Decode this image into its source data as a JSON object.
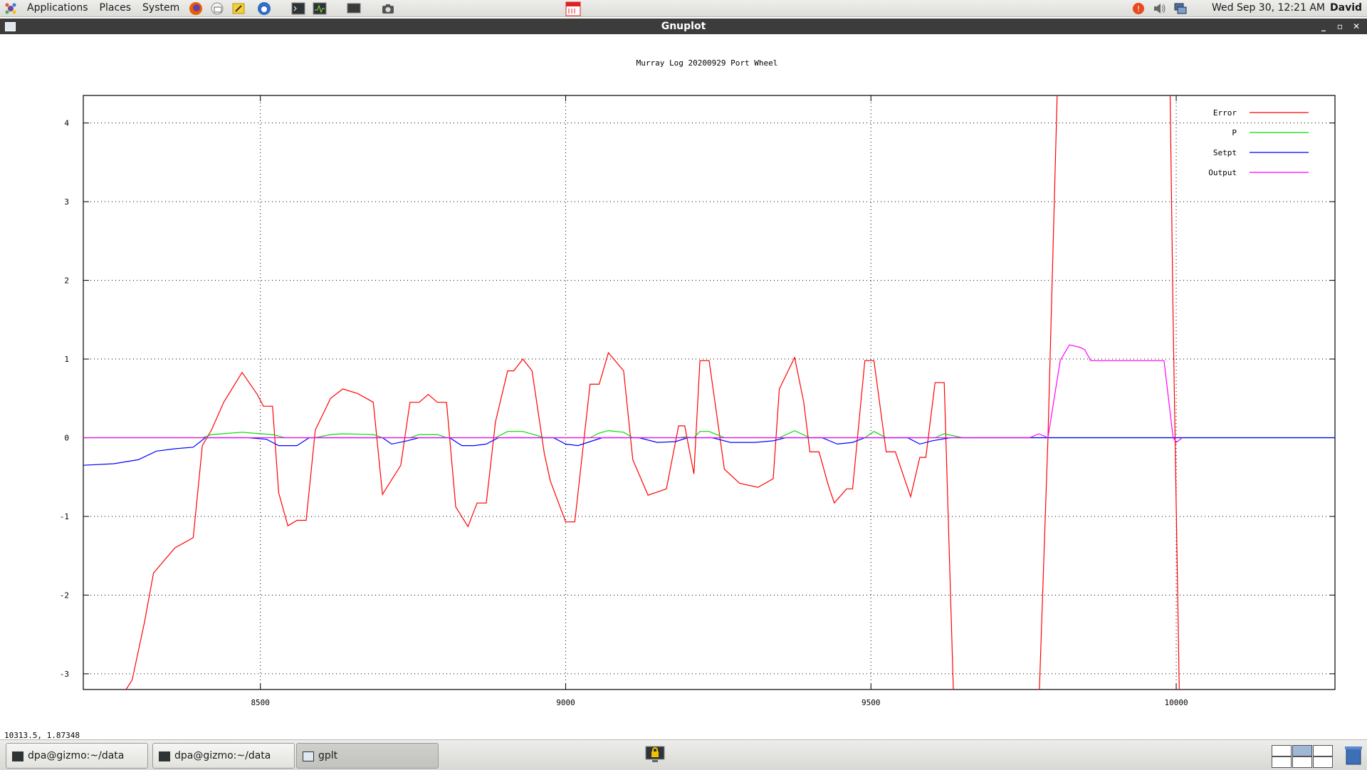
{
  "top_panel": {
    "menus": [
      "Applications",
      "Places",
      "System"
    ],
    "clock": "Wed Sep 30, 12:21 AM",
    "user": "David",
    "launchers": [
      "firefox-icon",
      "mail-icon",
      "notes-icon",
      "thunderbird-icon",
      "terminal-icon",
      "system-monitor-icon",
      "screen-icon",
      "camera-icon",
      "calendar-icon"
    ],
    "tray": [
      "update-icon",
      "volume-icon",
      "network-icon"
    ]
  },
  "window": {
    "title": "Gnuplot",
    "controls": [
      "_",
      "▫",
      "✕"
    ]
  },
  "status": {
    "coordinates": "10313.5,  1.87348"
  },
  "taskbar": {
    "items": [
      {
        "label": "dpa@gizmo:~/data"
      },
      {
        "label": "dpa@gizmo:~/data"
      },
      {
        "label": "gplt"
      }
    ]
  },
  "chart_data": {
    "type": "line",
    "title": "Murray Log 20200929 Port Wheel",
    "xlabel": "",
    "ylabel": "",
    "xlim": [
      8210,
      10260
    ],
    "ylim": [
      -3.2,
      4.35
    ],
    "x_ticks": [
      "8500",
      "9000",
      "9500",
      "10000"
    ],
    "x_tick_values": [
      8500,
      9000,
      9500,
      10000
    ],
    "y_ticks": [
      "4",
      "3",
      "2",
      "1",
      "0",
      "-1",
      "-2",
      "-3"
    ],
    "y_tick_values": [
      4,
      3,
      2,
      1,
      0,
      -1,
      -2,
      -3
    ],
    "grid": true,
    "legend_position": "top-right",
    "series": [
      {
        "name": "Error",
        "color": "#ff0000",
        "points": [
          [
            8280,
            -3.2
          ],
          [
            8290,
            -3.08
          ],
          [
            8310,
            -2.35
          ],
          [
            8325,
            -1.72
          ],
          [
            8360,
            -1.4
          ],
          [
            8390,
            -1.27
          ],
          [
            8405,
            -0.1
          ],
          [
            8420,
            0.1
          ],
          [
            8440,
            0.45
          ],
          [
            8470,
            0.83
          ],
          [
            8495,
            0.55
          ],
          [
            8505,
            0.4
          ],
          [
            8520,
            0.4
          ],
          [
            8530,
            -0.7
          ],
          [
            8545,
            -1.12
          ],
          [
            8560,
            -1.05
          ],
          [
            8575,
            -1.05
          ],
          [
            8590,
            0.1
          ],
          [
            8615,
            0.5
          ],
          [
            8635,
            0.62
          ],
          [
            8660,
            0.56
          ],
          [
            8685,
            0.45
          ],
          [
            8700,
            -0.72
          ],
          [
            8730,
            -0.35
          ],
          [
            8745,
            0.45
          ],
          [
            8760,
            0.45
          ],
          [
            8775,
            0.55
          ],
          [
            8790,
            0.45
          ],
          [
            8805,
            0.45
          ],
          [
            8820,
            -0.88
          ],
          [
            8840,
            -1.13
          ],
          [
            8855,
            -0.83
          ],
          [
            8870,
            -0.83
          ],
          [
            8885,
            0.2
          ],
          [
            8905,
            0.85
          ],
          [
            8915,
            0.85
          ],
          [
            8930,
            1.0
          ],
          [
            8945,
            0.85
          ],
          [
            8965,
            -0.2
          ],
          [
            8975,
            -0.55
          ],
          [
            9000,
            -1.07
          ],
          [
            9015,
            -1.07
          ],
          [
            9040,
            0.68
          ],
          [
            9055,
            0.68
          ],
          [
            9070,
            1.08
          ],
          [
            9095,
            0.85
          ],
          [
            9110,
            -0.28
          ],
          [
            9135,
            -0.73
          ],
          [
            9165,
            -0.65
          ],
          [
            9185,
            0.15
          ],
          [
            9195,
            0.15
          ],
          [
            9210,
            -0.46
          ],
          [
            9220,
            0.98
          ],
          [
            9235,
            0.98
          ],
          [
            9260,
            -0.4
          ],
          [
            9285,
            -0.58
          ],
          [
            9315,
            -0.63
          ],
          [
            9340,
            -0.52
          ],
          [
            9350,
            0.62
          ],
          [
            9375,
            1.02
          ],
          [
            9390,
            0.45
          ],
          [
            9400,
            -0.18
          ],
          [
            9415,
            -0.18
          ],
          [
            9430,
            -0.6
          ],
          [
            9440,
            -0.83
          ],
          [
            9460,
            -0.65
          ],
          [
            9470,
            -0.65
          ],
          [
            9490,
            0.98
          ],
          [
            9505,
            0.98
          ],
          [
            9525,
            -0.18
          ],
          [
            9540,
            -0.18
          ],
          [
            9565,
            -0.75
          ],
          [
            9580,
            -0.25
          ],
          [
            9590,
            -0.25
          ],
          [
            9605,
            0.7
          ],
          [
            9620,
            0.7
          ],
          [
            9635,
            -3.2
          ]
        ]
      },
      {
        "name": "Error",
        "color": "#ff0000",
        "points": [
          [
            9776,
            -3.2
          ],
          [
            9790,
            0.0
          ],
          [
            9805,
            4.35
          ]
        ]
      },
      {
        "name": "Error",
        "color": "#ff0000",
        "points": [
          [
            9990,
            4.35
          ],
          [
            9995,
            1.5
          ],
          [
            10005,
            -3.2
          ]
        ]
      },
      {
        "name": "P",
        "color": "#00dd00",
        "points": [
          [
            8210,
            0
          ],
          [
            8405,
            0
          ],
          [
            8420,
            0.04
          ],
          [
            8470,
            0.07
          ],
          [
            8500,
            0.05
          ],
          [
            8520,
            0.04
          ],
          [
            8540,
            0
          ],
          [
            8590,
            0
          ],
          [
            8615,
            0.04
          ],
          [
            8635,
            0.05
          ],
          [
            8685,
            0.04
          ],
          [
            8700,
            0
          ],
          [
            8745,
            0
          ],
          [
            8760,
            0.04
          ],
          [
            8790,
            0.04
          ],
          [
            8805,
            0
          ],
          [
            8885,
            0
          ],
          [
            8905,
            0.08
          ],
          [
            8930,
            0.08
          ],
          [
            8965,
            0
          ],
          [
            9040,
            0
          ],
          [
            9055,
            0.06
          ],
          [
            9070,
            0.09
          ],
          [
            9095,
            0.07
          ],
          [
            9110,
            0
          ],
          [
            9185,
            0
          ],
          [
            9195,
            0.01
          ],
          [
            9210,
            0
          ],
          [
            9220,
            0.08
          ],
          [
            9235,
            0.08
          ],
          [
            9260,
            0
          ],
          [
            9350,
            0
          ],
          [
            9375,
            0.09
          ],
          [
            9400,
            0
          ],
          [
            9490,
            0
          ],
          [
            9505,
            0.08
          ],
          [
            9525,
            0
          ],
          [
            9605,
            0
          ],
          [
            9620,
            0.05
          ],
          [
            9650,
            0
          ],
          [
            10260,
            0
          ]
        ]
      },
      {
        "name": "Setpt",
        "color": "#0000ff",
        "points": [
          [
            8210,
            -0.35
          ],
          [
            8260,
            -0.33
          ],
          [
            8300,
            -0.28
          ],
          [
            8330,
            -0.17
          ],
          [
            8360,
            -0.14
          ],
          [
            8390,
            -0.12
          ],
          [
            8410,
            0
          ],
          [
            8480,
            0
          ],
          [
            8510,
            -0.02
          ],
          [
            8530,
            -0.1
          ],
          [
            8560,
            -0.1
          ],
          [
            8580,
            0
          ],
          [
            8700,
            0
          ],
          [
            8715,
            -0.08
          ],
          [
            8740,
            -0.04
          ],
          [
            8760,
            0
          ],
          [
            8810,
            0
          ],
          [
            8830,
            -0.1
          ],
          [
            8850,
            -0.1
          ],
          [
            8870,
            -0.08
          ],
          [
            8890,
            0
          ],
          [
            8980,
            0
          ],
          [
            9000,
            -0.08
          ],
          [
            9020,
            -0.1
          ],
          [
            9040,
            -0.05
          ],
          [
            9060,
            0
          ],
          [
            9120,
            0
          ],
          [
            9150,
            -0.06
          ],
          [
            9180,
            -0.05
          ],
          [
            9200,
            0
          ],
          [
            9240,
            0
          ],
          [
            9270,
            -0.06
          ],
          [
            9310,
            -0.06
          ],
          [
            9340,
            -0.04
          ],
          [
            9360,
            0
          ],
          [
            9420,
            0
          ],
          [
            9445,
            -0.08
          ],
          [
            9470,
            -0.06
          ],
          [
            9490,
            0
          ],
          [
            9560,
            0
          ],
          [
            9580,
            -0.08
          ],
          [
            9600,
            -0.04
          ],
          [
            9630,
            0
          ],
          [
            10260,
            0
          ]
        ]
      },
      {
        "name": "Output",
        "color": "#ff00ff",
        "points": [
          [
            8210,
            0
          ],
          [
            9760,
            0
          ],
          [
            9775,
            0.05
          ],
          [
            9790,
            0
          ],
          [
            9810,
            0.98
          ],
          [
            9825,
            1.18
          ],
          [
            9842,
            1.15
          ],
          [
            9850,
            1.12
          ],
          [
            9860,
            0.98
          ],
          [
            9880,
            0.98
          ],
          [
            9980,
            0.98
          ],
          [
            9995,
            0.0
          ],
          [
            10000,
            -0.06
          ],
          [
            10010,
            0
          ]
        ]
      }
    ]
  }
}
